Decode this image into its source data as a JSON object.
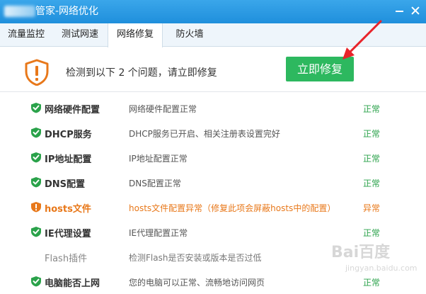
{
  "window": {
    "title": "管家-网络优化"
  },
  "tabs": [
    {
      "label": "流量监控",
      "active": false
    },
    {
      "label": "测试网速",
      "active": false
    },
    {
      "label": "网络修复",
      "active": true
    },
    {
      "label": "防火墙",
      "active": false
    }
  ],
  "alert": {
    "message": "检测到以下 2 个问题，请立即修复",
    "fix_button": "立即修复"
  },
  "colors": {
    "title_bar": "#2a9be3",
    "ok_green": "#2aa24a",
    "warn_orange": "#e8781a",
    "button_green": "#2db85f",
    "annotation_red": "#e8232a"
  },
  "items": [
    {
      "icon": "check-shield-icon",
      "name": "网络硬件配置",
      "desc": "网络硬件配置正常",
      "status": "正常",
      "state": "ok"
    },
    {
      "icon": "check-shield-icon",
      "name": "DHCP服务",
      "desc": "DHCP服务已开启、相关注册表设置完好",
      "status": "正常",
      "state": "ok"
    },
    {
      "icon": "check-shield-icon",
      "name": "IP地址配置",
      "desc": "IP地址配置正常",
      "status": "正常",
      "state": "ok"
    },
    {
      "icon": "check-shield-icon",
      "name": "DNS配置",
      "desc": "DNS配置正常",
      "status": "正常",
      "state": "ok"
    },
    {
      "icon": "warning-shield-icon",
      "name": "hosts文件",
      "desc": "hosts文件配置异常（修复此项会屏蔽hosts中的配置）",
      "status": "异常",
      "state": "warn"
    },
    {
      "icon": "check-shield-icon",
      "name": "IE代理设置",
      "desc": "IE代理配置正常",
      "status": "正常",
      "state": "ok"
    },
    {
      "icon": "",
      "name": "Flash插件",
      "desc": "检测Flash是否安装或版本是否过低",
      "status": "",
      "state": "checking"
    },
    {
      "icon": "check-shield-icon",
      "name": "电脑能否上网",
      "desc": "您的电脑可以正常、流畅地访问网页",
      "status": "正常",
      "state": "ok"
    }
  ],
  "watermark": {
    "main": "Bai百度",
    "sub": "jingyan.baidu.com"
  }
}
